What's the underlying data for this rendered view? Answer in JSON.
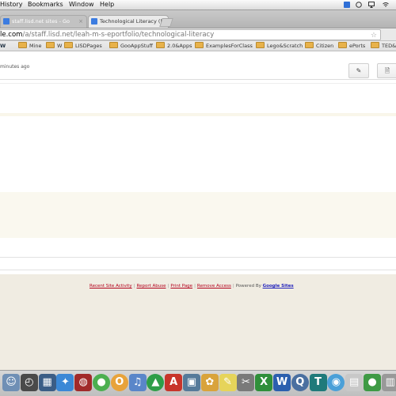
{
  "menubar": {
    "items": [
      "History",
      "Bookmarks",
      "Window",
      "Help"
    ]
  },
  "tabs": [
    {
      "title": "staff.lisd.net sites - Go",
      "active": false
    },
    {
      "title": "Technological Literacy (le",
      "active": true
    }
  ],
  "address_bar": {
    "host": "le.com",
    "path": "/a/staff.lisd.net/leah-m-s-eportfolio/technological-literacy"
  },
  "bookmarks": {
    "items": [
      {
        "label": "W",
        "icon": "w-icon"
      },
      {
        "label": "Mine",
        "icon": "folder-icon"
      },
      {
        "label": "W",
        "icon": "folder-icon"
      },
      {
        "label": "LISDPages",
        "icon": "folder-icon"
      },
      {
        "label": "GooAppStuff",
        "icon": "folder-icon"
      },
      {
        "label": "2.0&Apps",
        "icon": "folder-icon"
      },
      {
        "label": "ExamplesForClass",
        "icon": "folder-icon"
      },
      {
        "label": "Lego&Scratch",
        "icon": "folder-icon"
      },
      {
        "label": "Citizen",
        "icon": "folder-icon"
      },
      {
        "label": "ePorts",
        "icon": "folder-icon"
      },
      {
        "label": "TED&V",
        "icon": "folder-icon"
      }
    ]
  },
  "page": {
    "timestamp": "minutes ago",
    "toolbar": {
      "edit_icon": "✎",
      "new_page_icon": "🗎"
    }
  },
  "footer": {
    "recent_activity": "Recent Site Activity",
    "report_abuse": "Report Abuse",
    "print_page": "Print Page",
    "remove_access": "Remove Access",
    "powered_by": "Powered By",
    "google_sites": "Google Sites",
    "separator": "|"
  },
  "dock": {
    "icons": [
      {
        "name": "finder-icon",
        "glyph": "☺",
        "color": "#6f8fb5"
      },
      {
        "name": "dashboard-icon",
        "glyph": "◴",
        "color": "#4a4a4a"
      },
      {
        "name": "mission-control-icon",
        "glyph": "▦",
        "color": "#3b5d86"
      },
      {
        "name": "safari-icon",
        "glyph": "✦",
        "color": "#3b88d6"
      },
      {
        "name": "photo-booth-icon",
        "glyph": "◍",
        "color": "#a12a2a"
      },
      {
        "name": "chrome-icon",
        "glyph": "●",
        "color": "#4caf50"
      },
      {
        "name": "firefox-icon",
        "glyph": "O",
        "color": "#e8a33b"
      },
      {
        "name": "itunes-icon",
        "glyph": "♫",
        "color": "#5a86c9"
      },
      {
        "name": "google-drive-icon",
        "glyph": "▲",
        "color": "#2e9e48"
      },
      {
        "name": "acrobat-icon",
        "glyph": "A",
        "color": "#c8342b"
      },
      {
        "name": "preview-icon",
        "glyph": "▣",
        "color": "#567a9a"
      },
      {
        "name": "photos-icon",
        "glyph": "✿",
        "color": "#d9a33b"
      },
      {
        "name": "stickies-icon",
        "glyph": "✎",
        "color": "#e6d45a"
      },
      {
        "name": "scissors-icon",
        "glyph": "✂",
        "color": "#7a7a7a"
      },
      {
        "name": "excel-icon",
        "glyph": "X",
        "color": "#2f8f3a"
      },
      {
        "name": "word-icon",
        "glyph": "W",
        "color": "#2b5fae"
      },
      {
        "name": "quicktime-icon",
        "glyph": "Q",
        "color": "#4a6fa0"
      },
      {
        "name": "textedit-icon",
        "glyph": "T",
        "color": "#1f7a7a"
      },
      {
        "name": "app-store-icon",
        "glyph": "◉",
        "color": "#4aa0d8"
      },
      {
        "name": "document-icon",
        "glyph": "▤",
        "color": "#c8c8c8"
      },
      {
        "name": "downloads-icon",
        "glyph": "●",
        "color": "#3e9a45"
      },
      {
        "name": "trash-icon",
        "glyph": "▥",
        "color": "#999999"
      }
    ]
  }
}
